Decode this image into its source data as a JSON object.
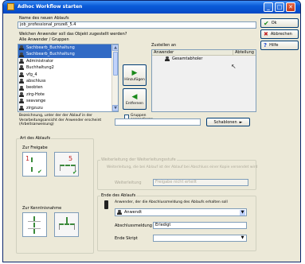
{
  "window": {
    "title": "Adhoc Workflow starten"
  },
  "fields": {
    "name_label": "Name des neuen Ablaufs",
    "name_value": "job_professional_prozeß_5.4",
    "question_label": "Welchen Anwender soll das Objekt zugestellt werden?",
    "all_users_label": "Alle Anwender / Gruppen",
    "assign_label": "Zustellen an",
    "description_label": "Bezeichnung, unter der der Ablauf in der Verarbeitungsansicht der Anwender erscheint (Arbeitsanweisung)",
    "description_value": ""
  },
  "users": [
    {
      "name": "Sachbearb_Buchhaltung",
      "selected": true
    },
    {
      "name": "Sachbearb_Buchhaltung",
      "selected": true
    },
    {
      "name": "Administrator",
      "selected": false
    },
    {
      "name": "Buchhaltung2",
      "selected": false
    },
    {
      "name": "vfg_4",
      "selected": false
    },
    {
      "name": "abschluss",
      "selected": false
    },
    {
      "name": "beobten",
      "selected": false
    },
    {
      "name": "zirg-Hote",
      "selected": false
    },
    {
      "name": "seavange",
      "selected": false
    },
    {
      "name": "zirgzuzu",
      "selected": false
    }
  ],
  "assign_table": {
    "columns": [
      "Anwender",
      "Abteilung"
    ],
    "rows": [
      {
        "anwender": "Gesamtabholer",
        "abteilung": ""
      }
    ]
  },
  "move": {
    "add_label": "Hinzufügen",
    "remove_label": "Entfernen",
    "groups_label": "Gruppen expandieren"
  },
  "buttons": {
    "ok": "Ok",
    "cancel": "Abbrechen",
    "help": "Hilfe",
    "templates": "Schablonen"
  },
  "flow": {
    "type_label": "Art des Ablaufs",
    "release_label": "Zur Freigabe",
    "circulation_label": "Zur Kenntnisnahme"
  },
  "weiterleitung": {
    "group_label": "Weiterleitung der Weiterleitungsstufe",
    "info": "Weiterleitung, die bei Ablauf ist der Ablauf bei Abschluss einer Kopie versendet wird",
    "field_label": "Weiterleitung",
    "field_value": "Freigabe nicht erteilt"
  },
  "end": {
    "group_label": "Ende des Ablaufs",
    "question": "Anwender, der die Abschlussmeldung des Ablaufs erhalten soll",
    "user_value": "Anwendt",
    "message_label": "Abschlussmeldung",
    "message_value": "Erledigt",
    "end_script_label": "Ende Skript",
    "end_script_value": ""
  },
  "icons": {
    "ok": "check-icon",
    "cancel": "x-icon",
    "help": "question-icon",
    "add": "arrow-right-icon",
    "remove": "arrow-left-icon"
  },
  "colors": {
    "titlebar": "#0a5bd8",
    "selection": "#316ac5",
    "ok_check": "#1a8a1a",
    "cancel_x": "#c02020",
    "help_q": "#1c4ad0"
  }
}
